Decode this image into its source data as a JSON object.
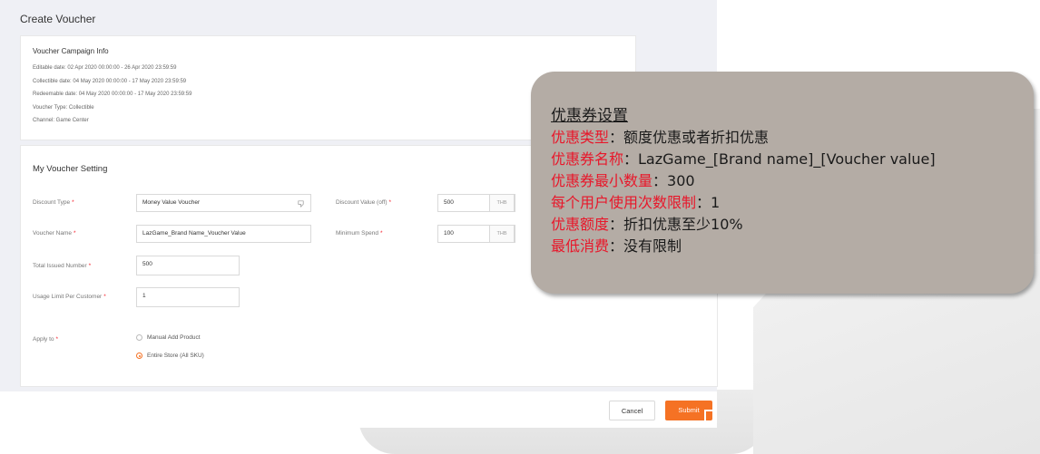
{
  "page": {
    "title": "Create Voucher"
  },
  "campaign_info": {
    "title": "Voucher Campaign Info",
    "lines": [
      "Editable date: 02 Apr 2020 00:00:00 - 26 Apr 2020 23:59:59",
      "Collectible date: 04 May 2020 00:00:00 - 17 May 2020 23:59:59",
      "Redeemable date: 04 May 2020 00:00:00 - 17 May 2020 23:59:59",
      "Voucher Type: Collectible",
      "Channel: Game Center"
    ]
  },
  "setting": {
    "title": "My Voucher Setting",
    "discount_type": {
      "label": "Discount Type",
      "required": "*",
      "value": "Money Value Voucher",
      "icon": "dropdown-icon"
    },
    "discount_value": {
      "label": "Discount Value (off)",
      "required": "*",
      "value": "500",
      "unit": "THB"
    },
    "voucher_name": {
      "label": "Voucher Name",
      "required": "*",
      "value": "LazGame_Brand Name_Voucher Value"
    },
    "minimum_spend": {
      "label": "Minimum Spend",
      "required": "*",
      "value": "100",
      "unit": "THB"
    },
    "total_issued": {
      "label": "Total Issued Number",
      "required": "*",
      "value": "500"
    },
    "usage_limit": {
      "label": "Usage Limit Per Customer",
      "required": "*",
      "value": "1"
    },
    "apply_to": {
      "label": "Apply to",
      "required": "*",
      "options": [
        {
          "label": "Manual Add Product",
          "selected": false
        },
        {
          "label": "Entire Store (All SKU)",
          "selected": true
        }
      ]
    }
  },
  "footer": {
    "cancel_label": "Cancel",
    "submit_label": "Submit"
  },
  "callout": {
    "title": "优惠券设置",
    "rows": [
      {
        "key": "优惠类型",
        "value": "：额度优惠或者折扣优惠"
      },
      {
        "key": "优惠券名称",
        "value": "：LazGame_[Brand name]_[Voucher value]"
      },
      {
        "key": "优惠券最小数量",
        "value": "：300"
      },
      {
        "key": "每个用户使用次数限制",
        "value": "：1"
      },
      {
        "key": "优惠额度",
        "value": "：折扣优惠至少10%"
      },
      {
        "key": "最低消费",
        "value": "：没有限制"
      }
    ]
  },
  "colors": {
    "accent": "#f57224",
    "required": "#f5222d",
    "callout_bg": "#b4aca5",
    "callout_key": "#e8172a"
  }
}
